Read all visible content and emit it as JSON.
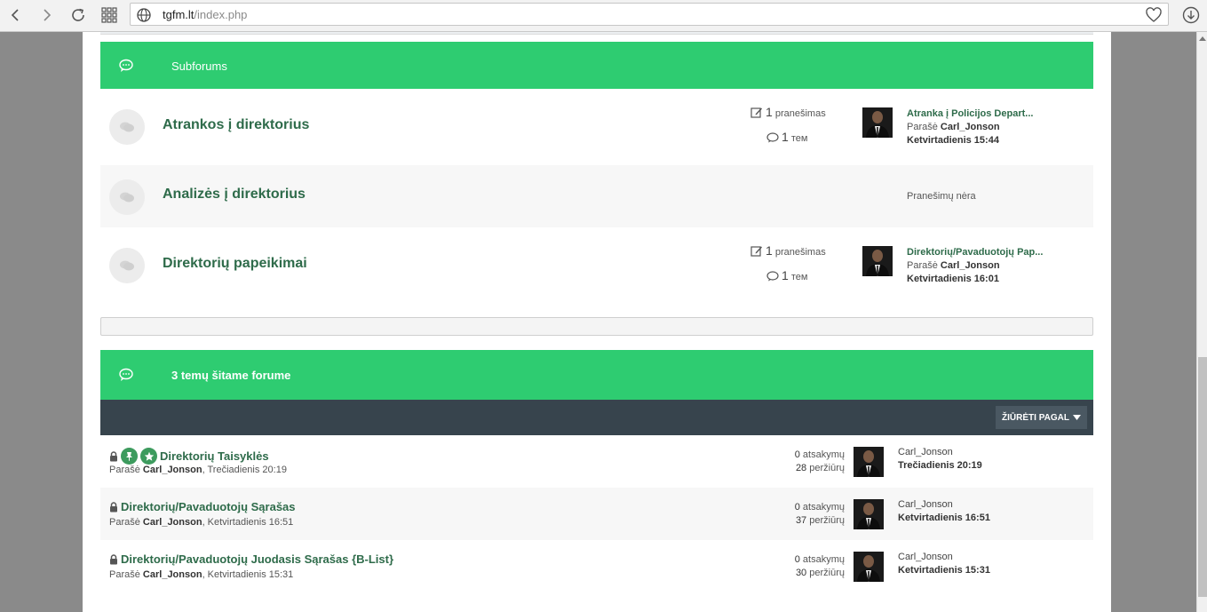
{
  "browser": {
    "url_host": "tgfm.lt",
    "url_path": "/index.php"
  },
  "subforums_header": {
    "title": "Subforums"
  },
  "forums": [
    {
      "title": "Atrankos į direktorius",
      "posts_count": "1",
      "posts_label": "pranešimas",
      "topics_count": "1",
      "topics_label": "тем",
      "last_post_title": "Atranka į Policijos Depart...",
      "by_label": "Parašė",
      "last_post_author": "Carl_Jonson",
      "last_post_date": "Ketvirtadienis 15:44"
    },
    {
      "title": "Analizės į direktorius",
      "no_posts_text": "Pranešimų nėra"
    },
    {
      "title": "Direktorių papeikimai",
      "posts_count": "1",
      "posts_label": "pranešimas",
      "topics_count": "1",
      "topics_label": "тем",
      "last_post_title": "Direktorių/Pavaduotojų Pap...",
      "by_label": "Parašė",
      "last_post_author": "Carl_Jonson",
      "last_post_date": "Ketvirtadienis 16:01"
    }
  ],
  "topics_header": {
    "title": "3 temų šitame forume"
  },
  "sort_button_label": "ŽIŪRĖTI PAGAL",
  "topics": [
    {
      "title": "Direktorių Taisyklės",
      "by_label": "Parašė",
      "author": "Carl_Jonson",
      "date": ", Trečiadienis 20:19",
      "replies": "0",
      "replies_label": "atsakymų",
      "views": "28",
      "views_label": "peržiūrų",
      "last_user": "Carl_Jonson",
      "last_date": "Trečiadienis 20:19"
    },
    {
      "title": "Direktorių/Pavaduotojų Sąrašas",
      "by_label": "Parašė",
      "author": "Carl_Jonson",
      "date": ", Ketvirtadienis 16:51",
      "replies": "0",
      "replies_label": "atsakymų",
      "views": "37",
      "views_label": "peržiūrų",
      "last_user": "Carl_Jonson",
      "last_date": "Ketvirtadienis 16:51"
    },
    {
      "title": "Direktorių/Pavaduotojų Juodasis Sąrašas {B-List}",
      "by_label": "Parašė",
      "author": "Carl_Jonson",
      "date": ", Ketvirtadienis 15:31",
      "replies": "0",
      "replies_label": "atsakymų",
      "views": "30",
      "views_label": "peržiūrų",
      "last_user": "Carl_Jonson",
      "last_date": "Ketvirtadienis 15:31"
    }
  ],
  "colors": {
    "accent_green": "#2ecc71",
    "link_green": "#2e6b4a",
    "dark_bar": "#37444d"
  }
}
